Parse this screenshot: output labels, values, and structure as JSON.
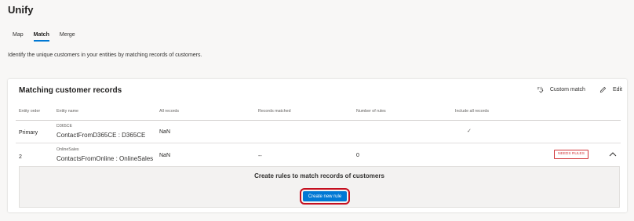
{
  "app": {
    "title": "Unify"
  },
  "tabs": [
    {
      "label": "Map",
      "active": false
    },
    {
      "label": "Match",
      "active": true
    },
    {
      "label": "Merge",
      "active": false
    }
  ],
  "description": "Identify the unique customers in your entities by matching records of customers.",
  "card": {
    "title": "Matching customer records",
    "actions": {
      "custom_match": "Custom match",
      "edit": "Edit"
    },
    "columns": [
      "Entity order",
      "Entity name",
      "All records",
      "Records matched",
      "Number of rules",
      "Include all records"
    ],
    "rows": [
      {
        "order": "Primary",
        "entity_source": "D365CE",
        "entity_name": "ContactFromD365CE : D365CE",
        "all_records": "NaN",
        "records_matched": "",
        "rules": "",
        "include_all": "✓"
      },
      {
        "order": "2",
        "entity_source": "OnlineSales",
        "entity_name": "ContactsFromOnline : OnlineSales",
        "all_records": "NaN",
        "records_matched": "--",
        "rules": "0",
        "include_all": "",
        "badge": "NEEDS RULES"
      }
    ],
    "panel": {
      "title": "Create rules to match records of customers",
      "button": "Create new rule"
    }
  },
  "colors": {
    "accent": "#0078d4",
    "badge": "#d13438",
    "highlight": "#c50f1f"
  }
}
